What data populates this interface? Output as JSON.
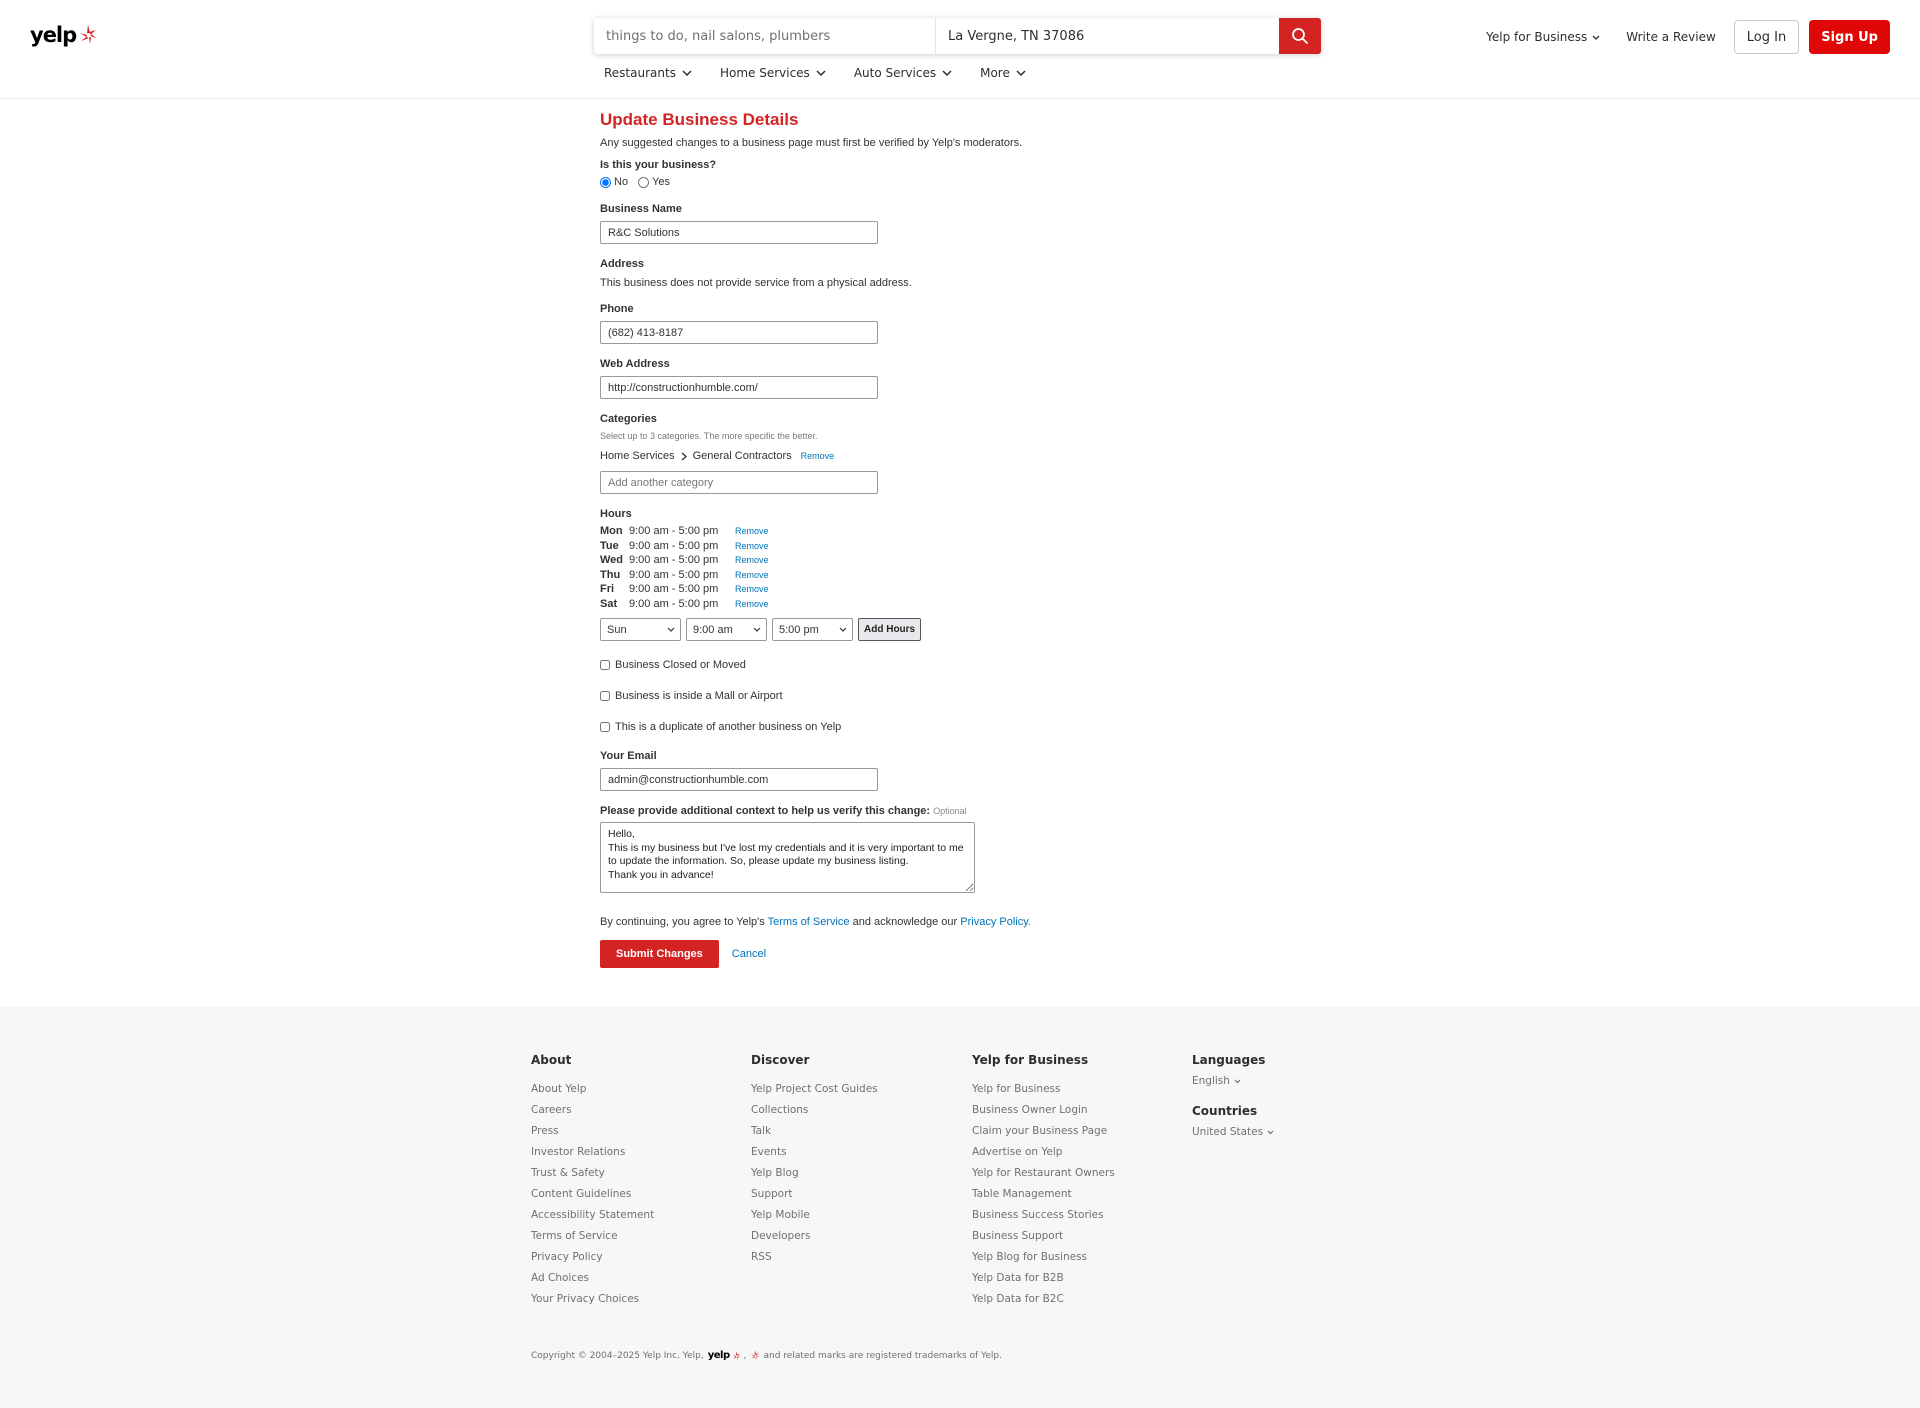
{
  "header": {
    "logo_text": "yelp",
    "search": {
      "find_placeholder": "things to do, nail salons, plumbers",
      "near_value": "La Vergne, TN 37086"
    },
    "categories": [
      "Restaurants",
      "Home Services",
      "Auto Services",
      "More"
    ],
    "yelp_for_business": "Yelp for Business",
    "write_review": "Write a Review",
    "login": "Log In",
    "signup": "Sign Up",
    "colors": {
      "brand_red": "#d32323",
      "signup_red": "#e00707"
    }
  },
  "form": {
    "title": "Update Business Details",
    "intro": "Any suggested changes to a business page must first be verified by Yelp's moderators.",
    "is_yours_label": "Is this your business?",
    "is_yours_options": [
      "No",
      "Yes"
    ],
    "is_yours_selected": "No",
    "business_name_label": "Business Name",
    "business_name_value": "R&C Solutions",
    "address_label": "Address",
    "address_text": "This business does not provide service from a physical address.",
    "phone_label": "Phone",
    "phone_value": "(682) 413-8187",
    "web_label": "Web Address",
    "web_value": "http://constructionhumble.com/",
    "categories_label": "Categories",
    "categories_hint": "Select up to 3 categories. The more specific the better.",
    "category_parent": "Home Services",
    "category_child": "General Contractors",
    "remove_label": "Remove",
    "add_category_placeholder": "Add another category",
    "hours_label": "Hours",
    "hours": [
      {
        "day": "Mon",
        "range": "9:00 am  -  5:00 pm"
      },
      {
        "day": "Tue",
        "range": "9:00 am  -  5:00 pm"
      },
      {
        "day": "Wed",
        "range": "9:00 am  -  5:00 pm"
      },
      {
        "day": "Thu",
        "range": "9:00 am  -  5:00 pm"
      },
      {
        "day": "Fri",
        "range": "9:00 am  -  5:00 pm"
      },
      {
        "day": "Sat",
        "range": "9:00 am  -  5:00 pm"
      }
    ],
    "new_hours": {
      "day": "Sun",
      "open": "9:00 am",
      "close": "5:00 pm",
      "button": "Add Hours"
    },
    "checkboxes": [
      "Business Closed or Moved",
      "Business is inside a Mall or Airport",
      "This is a duplicate of another business on Yelp"
    ],
    "email_label": "Your Email",
    "email_value": "admin@constructionhumble.com",
    "context_label": "Please provide additional context to help us verify this change:",
    "context_optional": "Optional",
    "context_value": "Hello,\nThis is my business but I've lost my credentials and it is very important to me to update the information. So, please update my business listing.\nThank you in advance!",
    "agree_prefix": "By continuing, you agree to Yelp's",
    "terms_link": "Terms of Service",
    "agree_middle": "and acknowledge our",
    "privacy_link": "Privacy Policy.",
    "submit": "Submit Changes",
    "cancel": "Cancel"
  },
  "footer": {
    "about": {
      "heading": "About",
      "links": [
        "About Yelp",
        "Careers",
        "Press",
        "Investor Relations",
        "Trust & Safety",
        "Content Guidelines",
        "Accessibility Statement",
        "Terms of Service",
        "Privacy Policy",
        "Ad Choices",
        "Your Privacy Choices"
      ]
    },
    "discover": {
      "heading": "Discover",
      "links": [
        "Yelp Project Cost Guides",
        "Collections",
        "Talk",
        "Events",
        "Yelp Blog",
        "Support",
        "Yelp Mobile",
        "Developers",
        "RSS"
      ]
    },
    "business": {
      "heading": "Yelp for Business",
      "links": [
        "Yelp for Business",
        "Business Owner Login",
        "Claim your Business Page",
        "Advertise on Yelp",
        "Yelp for Restaurant Owners",
        "Table Management",
        "Business Success Stories",
        "Business Support",
        "Yelp Blog for Business",
        "Yelp Data for B2B",
        "Yelp Data for B2C"
      ]
    },
    "languages_heading": "Languages",
    "language_value": "English",
    "countries_heading": "Countries",
    "country_value": "United States",
    "copyright_prefix": "Copyright © 2004–2025 Yelp Inc. Yelp,",
    "copyright_logo": "yelp",
    "copyright_suffix": "and related marks are registered trademarks of Yelp."
  }
}
